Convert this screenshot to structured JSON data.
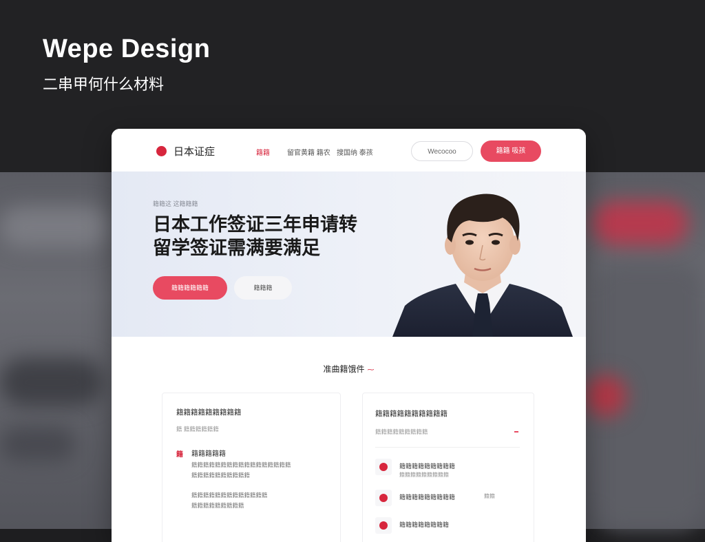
{
  "overlay": {
    "title": "Wepe Design",
    "subtitle": "二串甲何什么材料"
  },
  "nav": {
    "logo_text": "日本证症",
    "links": [
      "籍籍",
      "留官黄籍  籍农",
      "搜国纳  泰孩"
    ],
    "outline_button": "Wecocoo",
    "cta_button": "籍籍 吸孩"
  },
  "hero": {
    "tag": "籍籍这 这籍籍籍",
    "title_line1": "日本工作签证三年申请转",
    "title_line2": "留学签证需满要满足",
    "primary_button": "籍籍籍籍籍籍",
    "secondary_button": "籍籍籍"
  },
  "section": {
    "title": "准曲籍饿件"
  },
  "left_panel": {
    "title": "籍籍籍籍籍籍籍籍籍",
    "subtitle": "籍 籍籍籍籍籍籍",
    "item_icon": "籍",
    "item_title": "籍籍籍籍籍",
    "lines": [
      "籍籍籍籍籍籍籍籍籍籍籍籍籍籍籍籍籍",
      "籍籍籍籍籍籍籍籍籍籍",
      "籍籍籍籍籍籍籍籍籍籍籍籍籍",
      "籍籍籍籍籍籍籍籍籍"
    ]
  },
  "right_panel": {
    "title": "籍籍籍籍籍籍籍籍籍籍",
    "subtitle": "籍籍籍籍籍籍籍籍籍",
    "rows": [
      {
        "label": "籍籍籍籍籍籍籍籍籍",
        "sub": "籍籍籍籍籍籍籍籍籍",
        "aside": ""
      },
      {
        "label": "籍籍籍籍籍籍籍籍籍",
        "sub": "",
        "aside": "籍籍"
      },
      {
        "label": "籍籍籍籍籍籍籍籍",
        "sub": "",
        "aside": ""
      }
    ]
  },
  "colors": {
    "accent": "#d7263d",
    "accent_button": "#e84a61",
    "hero_bg": "#e9edf6"
  }
}
